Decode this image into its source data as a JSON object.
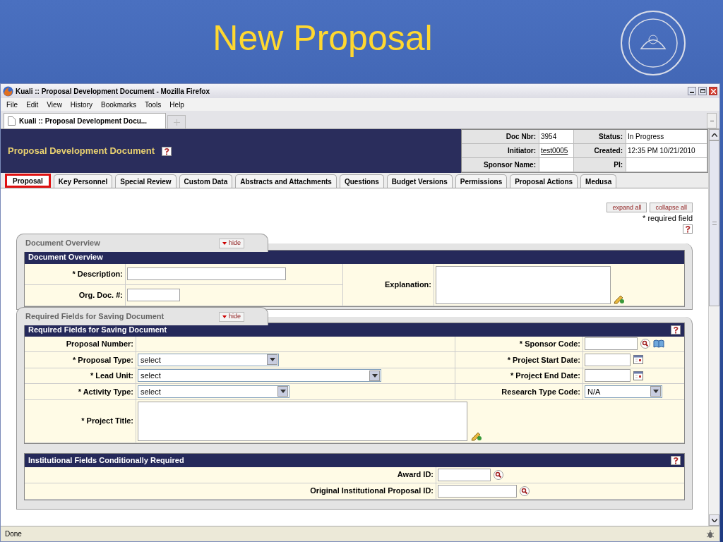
{
  "slide": {
    "title": "New Proposal"
  },
  "window": {
    "title": "Kuali :: Proposal Development Document - Mozilla Firefox"
  },
  "menu": [
    "File",
    "Edit",
    "View",
    "History",
    "Bookmarks",
    "Tools",
    "Help"
  ],
  "browser_tab": {
    "label": "Kuali :: Proposal Development Docu..."
  },
  "header": {
    "title": "Proposal Development Document",
    "info": [
      [
        {
          "label": "Doc Nbr:",
          "value": "3954"
        },
        {
          "label": "Status:",
          "value": "In Progress"
        }
      ],
      [
        {
          "label": "Initiator:",
          "value": "test0005",
          "link": true
        },
        {
          "label": "Created:",
          "value": "12:35 PM 10/21/2010"
        }
      ],
      [
        {
          "label": "Sponsor Name:"
        },
        {
          "label": "PI:"
        }
      ]
    ]
  },
  "tabs": [
    {
      "label": "Proposal",
      "selected": true
    },
    {
      "label": "Key Personnel",
      "selected": false
    },
    {
      "label": "Special Review",
      "selected": false
    },
    {
      "label": "Custom Data",
      "selected": false
    },
    {
      "label": "Abstracts and Attachments",
      "selected": false
    },
    {
      "label": "Questions",
      "selected": false
    },
    {
      "label": "Budget Versions",
      "selected": false
    },
    {
      "label": "Permissions",
      "selected": false
    },
    {
      "label": "Proposal Actions",
      "selected": false
    },
    {
      "label": "Medusa",
      "selected": false
    }
  ],
  "top_buttons": [
    "expand all",
    "collapse all"
  ],
  "required_note": "* required field",
  "document_overview": {
    "tab_title": "Document Overview",
    "hide": "hide",
    "header": "Document Overview",
    "fields": [
      {
        "label": "* Description:"
      },
      {
        "label": "Org. Doc. #:"
      }
    ],
    "explanation": {
      "label": "Explanation:"
    }
  },
  "required_section": {
    "tab_title": "Required Fields for Saving Document",
    "hide": "hide",
    "header": "Required Fields for Saving Document",
    "rows": [
      {
        "left": {
          "label": "Proposal Number:",
          "kind": "plain"
        },
        "right": {
          "label": "* Sponsor Code:",
          "kind": "lookup_book"
        }
      },
      {
        "left": {
          "label": "* Proposal Type:",
          "kind": "select",
          "value": "select"
        },
        "right": {
          "label": "* Project Start Date:",
          "kind": "date"
        }
      },
      {
        "left": {
          "label": "* Lead Unit:",
          "kind": "select",
          "value": "select"
        },
        "right": {
          "label": "* Project End Date:",
          "kind": "date"
        }
      },
      {
        "left": {
          "label": "* Activity Type:",
          "kind": "select",
          "value": "select"
        },
        "right": {
          "label": "Research Type Code:",
          "kind": "select",
          "value": "N/A"
        }
      }
    ],
    "title_field": {
      "label": "* Project Title:"
    }
  },
  "institutional": {
    "header": "Institutional Fields Conditionally Required",
    "fields": [
      {
        "label": "Award ID:",
        "kind": "lookup"
      },
      {
        "label": "Original Institutional Proposal ID:",
        "kind": "lookup"
      }
    ]
  },
  "status_bar": {
    "text": "Done"
  }
}
